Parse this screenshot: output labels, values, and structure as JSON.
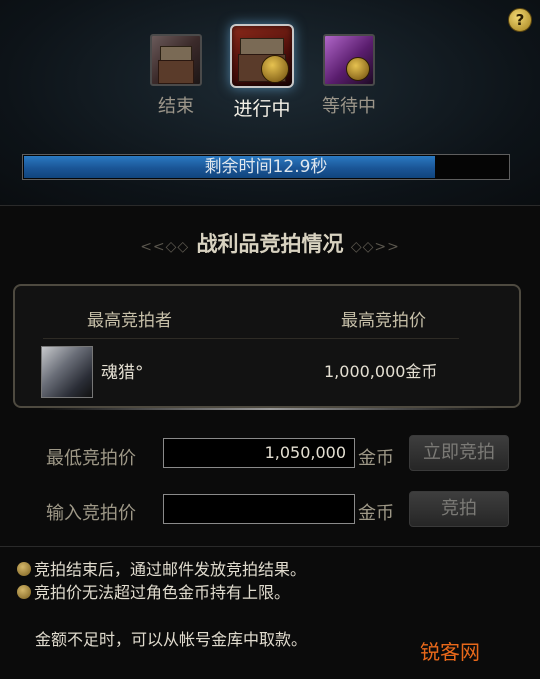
{
  "help": {
    "label": "?"
  },
  "stages": {
    "end": {
      "label": "结束",
      "icon": "chest-icon",
      "icon_text": "KW"
    },
    "current": {
      "label": "进行中",
      "icon": "chest-icon"
    },
    "waiting": {
      "label": "等待中",
      "icon": "gem-icon"
    }
  },
  "progress": {
    "text": "剩余时间12.9秒",
    "fraction": 0.85
  },
  "section": {
    "title": "战利品竞拍情况",
    "ornament_left": "<<◇◇",
    "ornament_right": "◇◇>>"
  },
  "bid_table": {
    "bidder_header": "最高竞拍者",
    "price_header": "最高竞拍价",
    "bidder_name": "魂猎°",
    "price": "1,000,000金币"
  },
  "min_bid": {
    "label": "最低竞拍价",
    "value": "1,050,000",
    "unit": "金币",
    "button": "立即竞拍"
  },
  "enter_bid": {
    "label": "输入竞拍价",
    "value": "",
    "unit": "金币",
    "button": "竞拍"
  },
  "notes": [
    "竞拍结束后，通过邮件发放竞拍结果。",
    "竞拍价无法超过角色金币持有上限。"
  ],
  "tip": "金额不足时，可以从帐号金库中取款。",
  "watermark": "锐客网",
  "colors": {
    "progress": "#1a5596",
    "accent": "#e8681a",
    "gold": "#d4b76a"
  }
}
